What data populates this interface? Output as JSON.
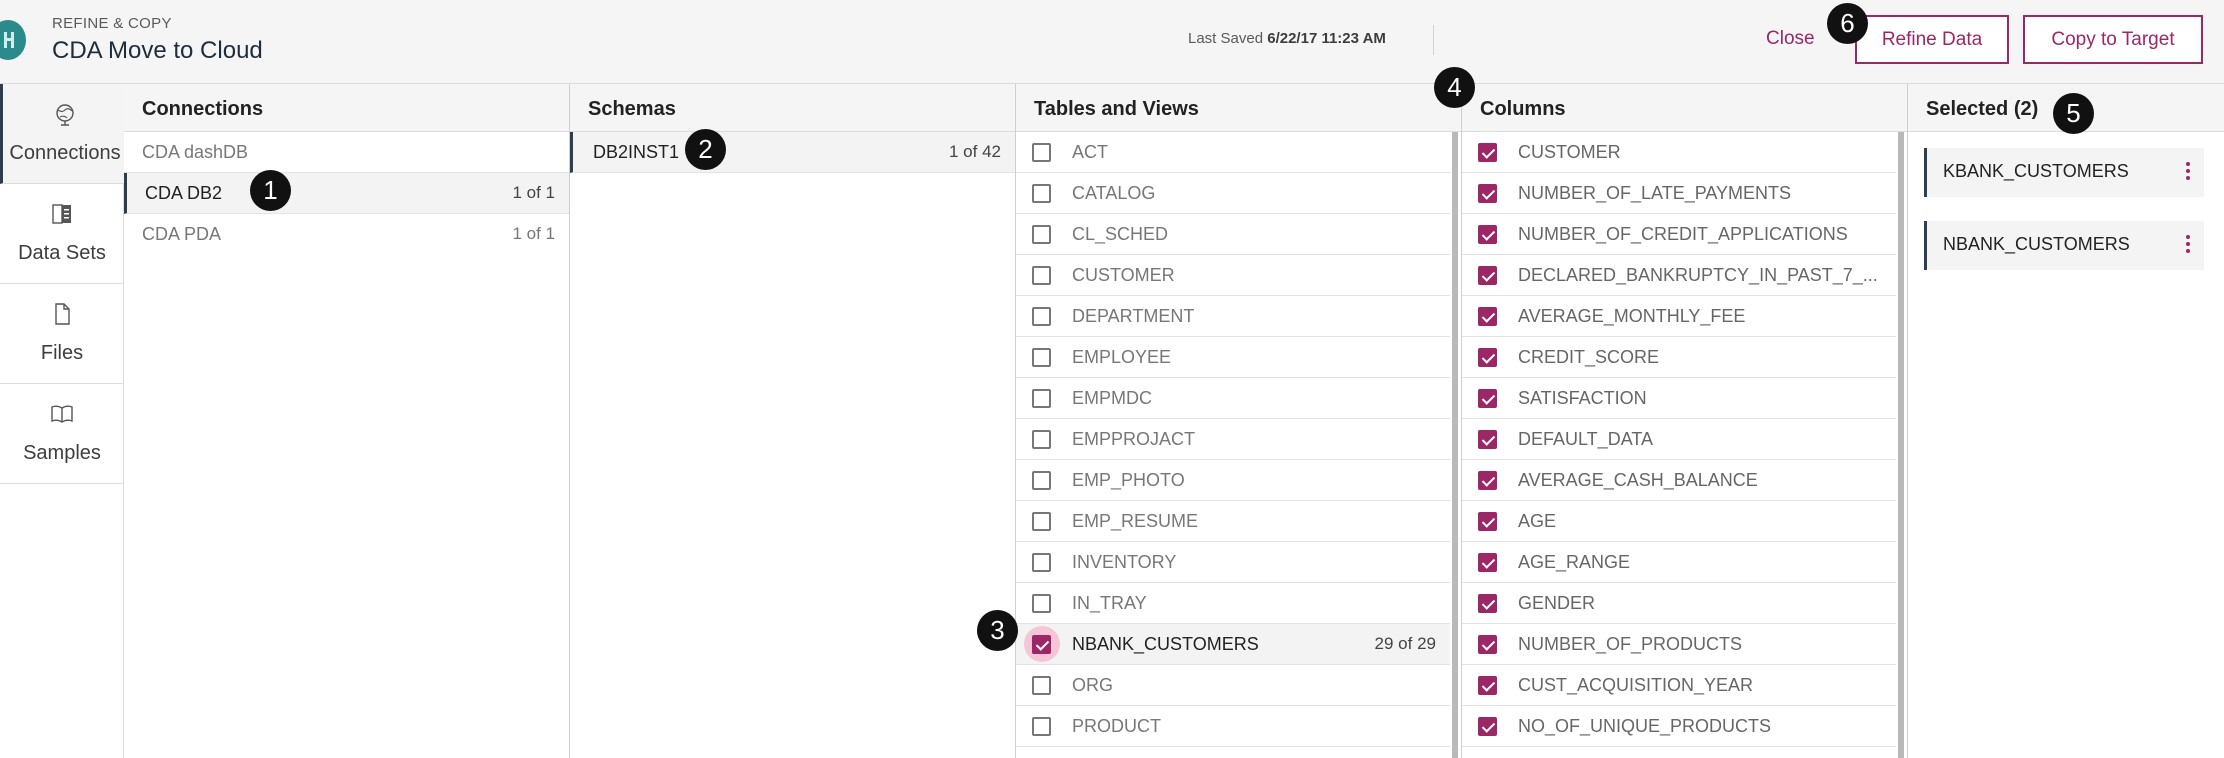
{
  "header": {
    "eyebrow": "REFINE & COPY",
    "title": "CDA Move to Cloud",
    "last_saved_label": "Last Saved",
    "last_saved_value": "6/22/17 11:23 AM",
    "close_label": "Close",
    "refine_label": "Refine Data",
    "copy_label": "Copy to Target"
  },
  "nav": [
    {
      "label": "Connections",
      "icon": "globe-icon",
      "active": true
    },
    {
      "label": "Data Sets",
      "icon": "data-set-icon",
      "active": false
    },
    {
      "label": "Files",
      "icon": "file-icon",
      "active": false
    },
    {
      "label": "Samples",
      "icon": "book-icon",
      "active": false
    }
  ],
  "connections": {
    "heading": "Connections",
    "items": [
      {
        "name": "CDA dashDB",
        "count": ""
      },
      {
        "name": "CDA DB2",
        "count": "1 of 1"
      },
      {
        "name": "CDA PDA",
        "count": "1 of 1"
      }
    ]
  },
  "schemas": {
    "heading": "Schemas",
    "items": [
      {
        "name": "DB2INST1",
        "count": "1 of 42"
      }
    ]
  },
  "tables": {
    "heading": "Tables and Views",
    "items": [
      {
        "name": "ACT",
        "checked": false,
        "count": ""
      },
      {
        "name": "CATALOG",
        "checked": false,
        "count": ""
      },
      {
        "name": "CL_SCHED",
        "checked": false,
        "count": ""
      },
      {
        "name": "CUSTOMER",
        "checked": false,
        "count": ""
      },
      {
        "name": "DEPARTMENT",
        "checked": false,
        "count": ""
      },
      {
        "name": "EMPLOYEE",
        "checked": false,
        "count": ""
      },
      {
        "name": "EMPMDC",
        "checked": false,
        "count": ""
      },
      {
        "name": "EMPPROJACT",
        "checked": false,
        "count": ""
      },
      {
        "name": "EMP_PHOTO",
        "checked": false,
        "count": ""
      },
      {
        "name": "EMP_RESUME",
        "checked": false,
        "count": ""
      },
      {
        "name": "INVENTORY",
        "checked": false,
        "count": ""
      },
      {
        "name": "IN_TRAY",
        "checked": false,
        "count": ""
      },
      {
        "name": "NBANK_CUSTOMERS",
        "checked": true,
        "count": "29 of 29"
      },
      {
        "name": "ORG",
        "checked": false,
        "count": ""
      },
      {
        "name": "PRODUCT",
        "checked": false,
        "count": ""
      }
    ]
  },
  "columns": {
    "heading": "Columns",
    "items": [
      "CUSTOMER",
      "NUMBER_OF_LATE_PAYMENTS",
      "NUMBER_OF_CREDIT_APPLICATIONS",
      "DECLARED_BANKRUPTCY_IN_PAST_7_...",
      "AVERAGE_MONTHLY_FEE",
      "CREDIT_SCORE",
      "SATISFACTION",
      "DEFAULT_DATA",
      "AVERAGE_CASH_BALANCE",
      "AGE",
      "AGE_RANGE",
      "GENDER",
      "NUMBER_OF_PRODUCTS",
      "CUST_ACQUISITION_YEAR",
      "NO_OF_UNIQUE_PRODUCTS"
    ]
  },
  "selected": {
    "heading": "Selected (2)",
    "items": [
      "KBANK_CUSTOMERS",
      "NBANK_CUSTOMERS"
    ]
  },
  "markers": [
    "1",
    "2",
    "3",
    "4",
    "5",
    "6"
  ],
  "colors": {
    "accent": "#9c2766",
    "nav_active_bar": "#2d3e50",
    "header_bg": "#f5f5f5"
  }
}
